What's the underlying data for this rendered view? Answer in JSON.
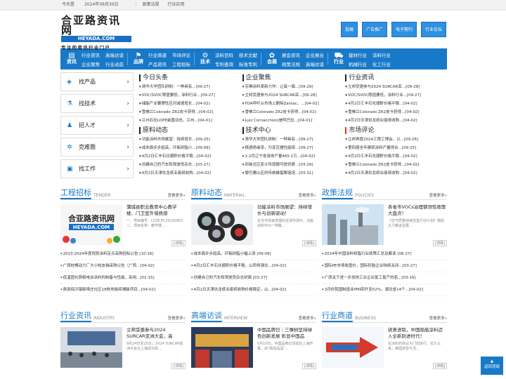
{
  "topbar": {
    "today_label": "今天是",
    "date": "2024年09月30日",
    "links": [
      "政策法规",
      "行业应用"
    ]
  },
  "logo": {
    "cn": "合亚路资讯网",
    "en": "HEYADA.COM",
    "slogan": "专注的资讯行业门户"
  },
  "header_buttons": [
    "投稿",
    "广告推广",
    "电子期刊",
    "行业论坛"
  ],
  "nav": [
    {
      "icon": "资讯",
      "links": [
        "行业资讯",
        "高端访谈",
        "企业聚焦",
        "行业动态"
      ]
    },
    {
      "icon": "品牌",
      "links": [
        "行业商道",
        "市场评论",
        "产品资讯",
        "工程招标"
      ]
    },
    {
      "icon": "技术",
      "links": [
        "涂料百科",
        "技术文献",
        "专利查询",
        "标准专利"
      ]
    },
    {
      "icon": "会展",
      "links": [
        "展会资讯",
        "企业展台",
        "政策法规",
        "高端访谈"
      ]
    },
    {
      "icon": "行业",
      "links": [
        "建材行业",
        "涂料行业",
        "机械行业",
        "化工行业"
      ]
    }
  ],
  "sidebar": [
    "找产品",
    "找技术",
    "招人才",
    "克难题",
    "找工作"
  ],
  "news_cols": [
    {
      "blocks": [
        {
          "title": "今日头条",
          "items": [
            "清华大学团队研制：一种具有...[09-27]",
            "VOC/SVOC限值要低，涂料行业...[09-27]",
            "储能产业要理性应对减速增长...[04-02]",
            "雪佛兰Colorado ZR2皮卡获得...[04-02]",
            "兰州石化LDPE装置动态，兰州...[04-01]"
          ]
        },
        {
          "title": "原料动态",
          "items": [
            "功能涂料市场展望：持续增长...[09-25]",
            "成本面步步趋高，环氧树脂小...[09-09]",
            "4月2日汇丰石化顺酐价格平稳...[04-02]",
            "创建自己的汽车和驾驶员杂志...[03-27]",
            "4月2日天津玖龙纸业废纸收购...[04-02]"
          ]
        }
      ]
    },
    {
      "blocks": [
        {
          "title": "企业聚焦",
          "items": [
            "芬琳涂料革新力作：让每一面...[09-29]",
            "立邦受邀参与2024 SURCAR亚...[09-28]",
            "FDA呼吁从市场上删除Zantac，...[04-02]",
            "雪佛兰Colorado ZR2皮卡获得...[04-02]",
            "Luiz Cornacchioni是阿巴拉...[04-01]"
          ]
        },
        {
          "title": "技术中心",
          "items": [
            "清华大学团队研制：一种具有...[09-27]",
            "精透绝缘漆，为变压器性能保...[09-27]",
            "1-2月辽宁省液体产量465.1万...[04-02]",
            "封装式应变计传感器可提供更...[03-29]",
            "黎巴嫩山区的传统蜂蜜酿造培...[03-31]"
          ]
        }
      ]
    },
    {
      "blocks": [
        {
          "title": "行业资讯",
          "items": [
            "立邦受邀参与2024 SURCAR亚...[09-28]",
            "VOC/SVOC限值要低，涂料行业...[09-27]",
            "4月2日汇丰石化顺酐价格平稳...[04-02]",
            "雪佛兰Colorado ZR2皮卡获得...[04-02]",
            "4月2日天津玖龙纸业废纸收购...[04-02]"
          ]
        },
        {
          "title": "市场评论",
          "items": [
            "立邦再度2024工程工博会，以...[09-26]",
            "第四届全年建筑涂料产量得合...[09-25]",
            "4月2日汇丰石化顺酐价格平稳...[04-02]",
            "雪佛兰Colorado ZR2皮卡获得...[04-02]",
            "4月2日天津玖龙纸业废纸收购...[04-02]"
          ]
        }
      ]
    }
  ],
  "sections_row1": [
    {
      "title": "工程招标",
      "en": "TENDER",
      "more": "查看更多»",
      "card_title": "蒲城县职业教育中心教学楼、门卫室外墙质感",
      "card_desc": "一、项目编号：LYZB-PC20230902二、项目名称：教学楼...",
      "detail": "[详情]",
      "items": [
        "2023-2024年度规划涂料定点采购招标公告 [10-16]",
        "广西桂槐动力厂大小校友轴采购公告（广西...[04-02]",
        "低温固化阴极电泳涂料的制备与性能，采用...[01-15]",
        "费县探沂镇柴埠庄社区18栋地板砖铺装项目...[04-02]"
      ]
    },
    {
      "title": "原料动态",
      "en": "MATERIAL",
      "more": "查看更多»",
      "card_title": "功能涂料市场展望：持续增长与创新驱动！",
      "card_desc": "在当今快速发展的全球市场中，功能涂料作为一种集...",
      "detail": "[详情]",
      "items": [
        "成本面步步趋高，环氧树脂小幅上涨 [09-09]",
        "4月2日汇丰石化顺酐价格平稳，山西恒强化...[04-02]",
        "创建自己的汽车和驾驶员杂志封面 [03-27]",
        "4月2日天津玖龙纸业废纸收购价格稳定，山...[04-02]"
      ]
    },
    {
      "title": "政策法规",
      "en": "POLICIES",
      "more": "查看更多»",
      "card_title": "各省市VOCs治理钢领性政策大盘点！",
      "card_desc": "《空气质量持续改善行动计划》鼓励大力推进显著...",
      "detail": "[详情]",
      "items": [
        "2024年中国涂料树脂行业政策汇总及解读 [06-27]",
        "国际PE市场收盘价，国际轮胎企业陆续关闭...[03-27]",
        "广西关于进一步加快工业企业复工复产的若...[03-16]",
        "3月份我国制造业PMI回升至52%，湖北省14个...[04-02]"
      ]
    }
  ],
  "sections_row2": [
    {
      "title": "行业资讯",
      "en": "INDUSTRY",
      "more": "查看更多»",
      "card_title": "立邦受邀参与2024 SURCAR亚洲大会，高",
      "card_desc": "9月24日至25日，2024 SURCAR亚洲大会在上海成功举...",
      "detail": "[详情]"
    },
    {
      "title": "高端访谈",
      "en": "INTERVIEW",
      "more": "查看更多»",
      "card_title": "中国品牌日｜三棵树坚持绿色创新发展 彰显中国品",
      "card_desc": "5月10日，中国品牌日活动在上海开幕，由\"搞完品品\"...",
      "detail": "[详情]"
    },
    {
      "title": "行业商道",
      "en": "BUSINESS",
      "more": "查看更多»",
      "card_title": "锐意进取，中国船舶涂料迈入全新跃进时代！",
      "card_desc": "在涂料的商业大门前进行，长久以来，美国波音与活...",
      "detail": "[详情]"
    }
  ],
  "backtop": "返回顶部"
}
